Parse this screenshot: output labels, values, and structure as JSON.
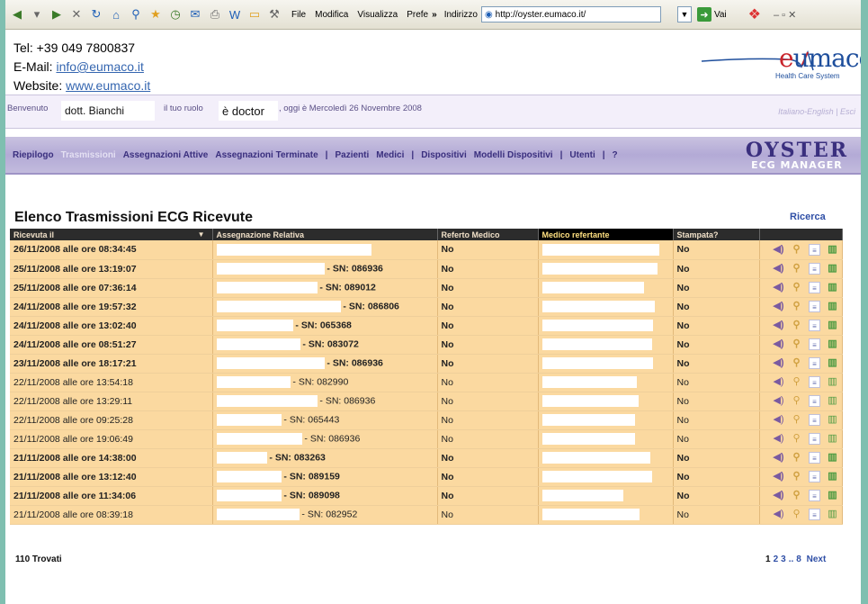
{
  "browser": {
    "menus": [
      "File",
      "Modifica",
      "Visualizza",
      "Prefe"
    ],
    "overflow": "»",
    "address_label": "Indirizzo",
    "url": "http://oyster.eumaco.it/",
    "go_label": "Vai"
  },
  "contact": {
    "tel": "Tel: +39 049 7800837",
    "email_label": "E-Mail: ",
    "email": "info@eumaco.it",
    "website_label": "Website: ",
    "website": "www.eumaco.it"
  },
  "brand": {
    "name_e": "e",
    "name_rest": "umaco",
    "subtitle": "Health Care System"
  },
  "welcome": {
    "benvenuto": "Benvenuto",
    "user": "dott. Bianchi",
    "ruolo_label": "il tuo ruolo",
    "ruolo": "è doctor",
    "date_text": ", oggi è Mercoledì 26 Novembre 2008",
    "languages": "Italiano-English | Esci"
  },
  "nav": {
    "items": [
      {
        "label": "Riepilogo"
      },
      {
        "label": "Trasmissioni",
        "active": true
      },
      {
        "label": "Assegnazioni Attive"
      },
      {
        "label": "Assegnazioni Terminate"
      },
      {
        "label": "|"
      },
      {
        "label": "Pazienti"
      },
      {
        "label": "Medici"
      },
      {
        "label": "|"
      },
      {
        "label": "Dispositivi"
      },
      {
        "label": "Modelli Dispositivi"
      },
      {
        "label": "|"
      },
      {
        "label": "Utenti"
      },
      {
        "label": "|"
      },
      {
        "label": "?"
      }
    ],
    "logo_big": "OYSTER",
    "logo_small": "ECG MANAGER"
  },
  "list": {
    "title": "Elenco Trasmissioni ECG Ricevute",
    "search": "Ricerca",
    "columns": [
      "Ricevuta il",
      "Assegnazione Relativa",
      "Referto Medico",
      "Medico refertante",
      "Stampata?"
    ],
    "rows": [
      {
        "ricevuta": "26/11/2008 alle ore 08:34:45",
        "sn": "",
        "referto": "No",
        "stampata": "No",
        "bold": true
      },
      {
        "ricevuta": "25/11/2008 alle ore 13:19:07",
        "sn": "- SN: 086936",
        "referto": "No",
        "stampata": "No",
        "bold": true
      },
      {
        "ricevuta": "25/11/2008 alle ore 07:36:14",
        "sn": "- SN: 089012",
        "referto": "No",
        "stampata": "No",
        "bold": true
      },
      {
        "ricevuta": "24/11/2008 alle ore 19:57:32",
        "sn": "- SN: 086806",
        "referto": "No",
        "stampata": "No",
        "bold": true
      },
      {
        "ricevuta": "24/11/2008 alle ore 13:02:40",
        "sn": "- SN: 065368",
        "referto": "No",
        "stampata": "No",
        "bold": true
      },
      {
        "ricevuta": "24/11/2008 alle ore 08:51:27",
        "sn": "- SN: 083072",
        "referto": "No",
        "stampata": "No",
        "bold": true
      },
      {
        "ricevuta": "23/11/2008 alle ore 18:17:21",
        "sn": "- SN: 086936",
        "referto": "No",
        "stampata": "No",
        "bold": true
      },
      {
        "ricevuta": "22/11/2008 alle ore 13:54:18",
        "sn": "- SN: 082990",
        "referto": "No",
        "stampata": "No",
        "bold": false
      },
      {
        "ricevuta": "22/11/2008 alle ore 13:29:11",
        "sn": "- SN: 086936",
        "referto": "No",
        "stampata": "No",
        "bold": false
      },
      {
        "ricevuta": "22/11/2008 alle ore 09:25:28",
        "sn": "- SN: 065443",
        "referto": "No",
        "stampata": "No",
        "bold": false
      },
      {
        "ricevuta": "21/11/2008 alle ore 19:06:49",
        "sn": "- SN: 086936",
        "referto": "No",
        "stampata": "No",
        "bold": false
      },
      {
        "ricevuta": "21/11/2008 alle ore 14:38:00",
        "sn": "- SN: 083263",
        "referto": "No",
        "stampata": "No",
        "bold": true
      },
      {
        "ricevuta": "21/11/2008 alle ore 13:12:40",
        "sn": "- SN: 089159",
        "referto": "No",
        "stampata": "No",
        "bold": true
      },
      {
        "ricevuta": "21/11/2008 alle ore 11:34:06",
        "sn": "- SN: 089098",
        "referto": "No",
        "stampata": "No",
        "bold": true
      },
      {
        "ricevuta": "21/11/2008 alle ore 08:39:18",
        "sn": "- SN: 082952",
        "referto": "No",
        "stampata": "No",
        "bold": false
      }
    ],
    "row_icons": [
      "speaker-icon",
      "magnifier-icon",
      "document-icon",
      "barcode-icon"
    ],
    "total": "110 Trovati",
    "pager": {
      "pages": [
        "1",
        "2",
        "3",
        "..",
        "8"
      ],
      "next": "Next"
    }
  },
  "colors": {
    "row_bg": "#fbd9a0",
    "nav_bg": "#b3aad6",
    "header_bg": "#2c2c2c",
    "accent_link": "#2f4fa6"
  }
}
